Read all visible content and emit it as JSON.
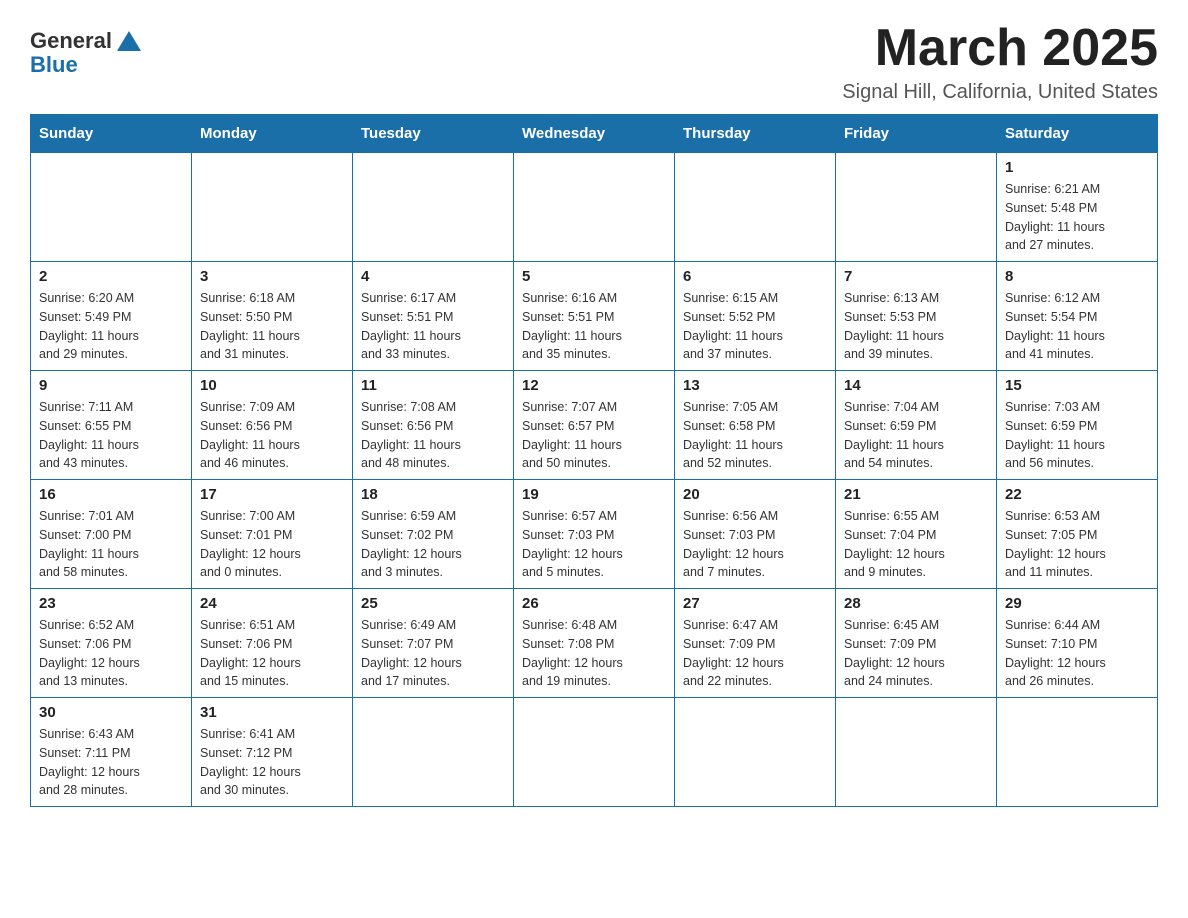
{
  "header": {
    "logo_general": "General",
    "logo_blue": "Blue",
    "title": "March 2025",
    "subtitle": "Signal Hill, California, United States"
  },
  "weekdays": [
    "Sunday",
    "Monday",
    "Tuesday",
    "Wednesday",
    "Thursday",
    "Friday",
    "Saturday"
  ],
  "weeks": [
    [
      {
        "day": "",
        "info": ""
      },
      {
        "day": "",
        "info": ""
      },
      {
        "day": "",
        "info": ""
      },
      {
        "day": "",
        "info": ""
      },
      {
        "day": "",
        "info": ""
      },
      {
        "day": "",
        "info": ""
      },
      {
        "day": "1",
        "info": "Sunrise: 6:21 AM\nSunset: 5:48 PM\nDaylight: 11 hours\nand 27 minutes."
      }
    ],
    [
      {
        "day": "2",
        "info": "Sunrise: 6:20 AM\nSunset: 5:49 PM\nDaylight: 11 hours\nand 29 minutes."
      },
      {
        "day": "3",
        "info": "Sunrise: 6:18 AM\nSunset: 5:50 PM\nDaylight: 11 hours\nand 31 minutes."
      },
      {
        "day": "4",
        "info": "Sunrise: 6:17 AM\nSunset: 5:51 PM\nDaylight: 11 hours\nand 33 minutes."
      },
      {
        "day": "5",
        "info": "Sunrise: 6:16 AM\nSunset: 5:51 PM\nDaylight: 11 hours\nand 35 minutes."
      },
      {
        "day": "6",
        "info": "Sunrise: 6:15 AM\nSunset: 5:52 PM\nDaylight: 11 hours\nand 37 minutes."
      },
      {
        "day": "7",
        "info": "Sunrise: 6:13 AM\nSunset: 5:53 PM\nDaylight: 11 hours\nand 39 minutes."
      },
      {
        "day": "8",
        "info": "Sunrise: 6:12 AM\nSunset: 5:54 PM\nDaylight: 11 hours\nand 41 minutes."
      }
    ],
    [
      {
        "day": "9",
        "info": "Sunrise: 7:11 AM\nSunset: 6:55 PM\nDaylight: 11 hours\nand 43 minutes."
      },
      {
        "day": "10",
        "info": "Sunrise: 7:09 AM\nSunset: 6:56 PM\nDaylight: 11 hours\nand 46 minutes."
      },
      {
        "day": "11",
        "info": "Sunrise: 7:08 AM\nSunset: 6:56 PM\nDaylight: 11 hours\nand 48 minutes."
      },
      {
        "day": "12",
        "info": "Sunrise: 7:07 AM\nSunset: 6:57 PM\nDaylight: 11 hours\nand 50 minutes."
      },
      {
        "day": "13",
        "info": "Sunrise: 7:05 AM\nSunset: 6:58 PM\nDaylight: 11 hours\nand 52 minutes."
      },
      {
        "day": "14",
        "info": "Sunrise: 7:04 AM\nSunset: 6:59 PM\nDaylight: 11 hours\nand 54 minutes."
      },
      {
        "day": "15",
        "info": "Sunrise: 7:03 AM\nSunset: 6:59 PM\nDaylight: 11 hours\nand 56 minutes."
      }
    ],
    [
      {
        "day": "16",
        "info": "Sunrise: 7:01 AM\nSunset: 7:00 PM\nDaylight: 11 hours\nand 58 minutes."
      },
      {
        "day": "17",
        "info": "Sunrise: 7:00 AM\nSunset: 7:01 PM\nDaylight: 12 hours\nand 0 minutes."
      },
      {
        "day": "18",
        "info": "Sunrise: 6:59 AM\nSunset: 7:02 PM\nDaylight: 12 hours\nand 3 minutes."
      },
      {
        "day": "19",
        "info": "Sunrise: 6:57 AM\nSunset: 7:03 PM\nDaylight: 12 hours\nand 5 minutes."
      },
      {
        "day": "20",
        "info": "Sunrise: 6:56 AM\nSunset: 7:03 PM\nDaylight: 12 hours\nand 7 minutes."
      },
      {
        "day": "21",
        "info": "Sunrise: 6:55 AM\nSunset: 7:04 PM\nDaylight: 12 hours\nand 9 minutes."
      },
      {
        "day": "22",
        "info": "Sunrise: 6:53 AM\nSunset: 7:05 PM\nDaylight: 12 hours\nand 11 minutes."
      }
    ],
    [
      {
        "day": "23",
        "info": "Sunrise: 6:52 AM\nSunset: 7:06 PM\nDaylight: 12 hours\nand 13 minutes."
      },
      {
        "day": "24",
        "info": "Sunrise: 6:51 AM\nSunset: 7:06 PM\nDaylight: 12 hours\nand 15 minutes."
      },
      {
        "day": "25",
        "info": "Sunrise: 6:49 AM\nSunset: 7:07 PM\nDaylight: 12 hours\nand 17 minutes."
      },
      {
        "day": "26",
        "info": "Sunrise: 6:48 AM\nSunset: 7:08 PM\nDaylight: 12 hours\nand 19 minutes."
      },
      {
        "day": "27",
        "info": "Sunrise: 6:47 AM\nSunset: 7:09 PM\nDaylight: 12 hours\nand 22 minutes."
      },
      {
        "day": "28",
        "info": "Sunrise: 6:45 AM\nSunset: 7:09 PM\nDaylight: 12 hours\nand 24 minutes."
      },
      {
        "day": "29",
        "info": "Sunrise: 6:44 AM\nSunset: 7:10 PM\nDaylight: 12 hours\nand 26 minutes."
      }
    ],
    [
      {
        "day": "30",
        "info": "Sunrise: 6:43 AM\nSunset: 7:11 PM\nDaylight: 12 hours\nand 28 minutes."
      },
      {
        "day": "31",
        "info": "Sunrise: 6:41 AM\nSunset: 7:12 PM\nDaylight: 12 hours\nand 30 minutes."
      },
      {
        "day": "",
        "info": ""
      },
      {
        "day": "",
        "info": ""
      },
      {
        "day": "",
        "info": ""
      },
      {
        "day": "",
        "info": ""
      },
      {
        "day": "",
        "info": ""
      }
    ]
  ]
}
